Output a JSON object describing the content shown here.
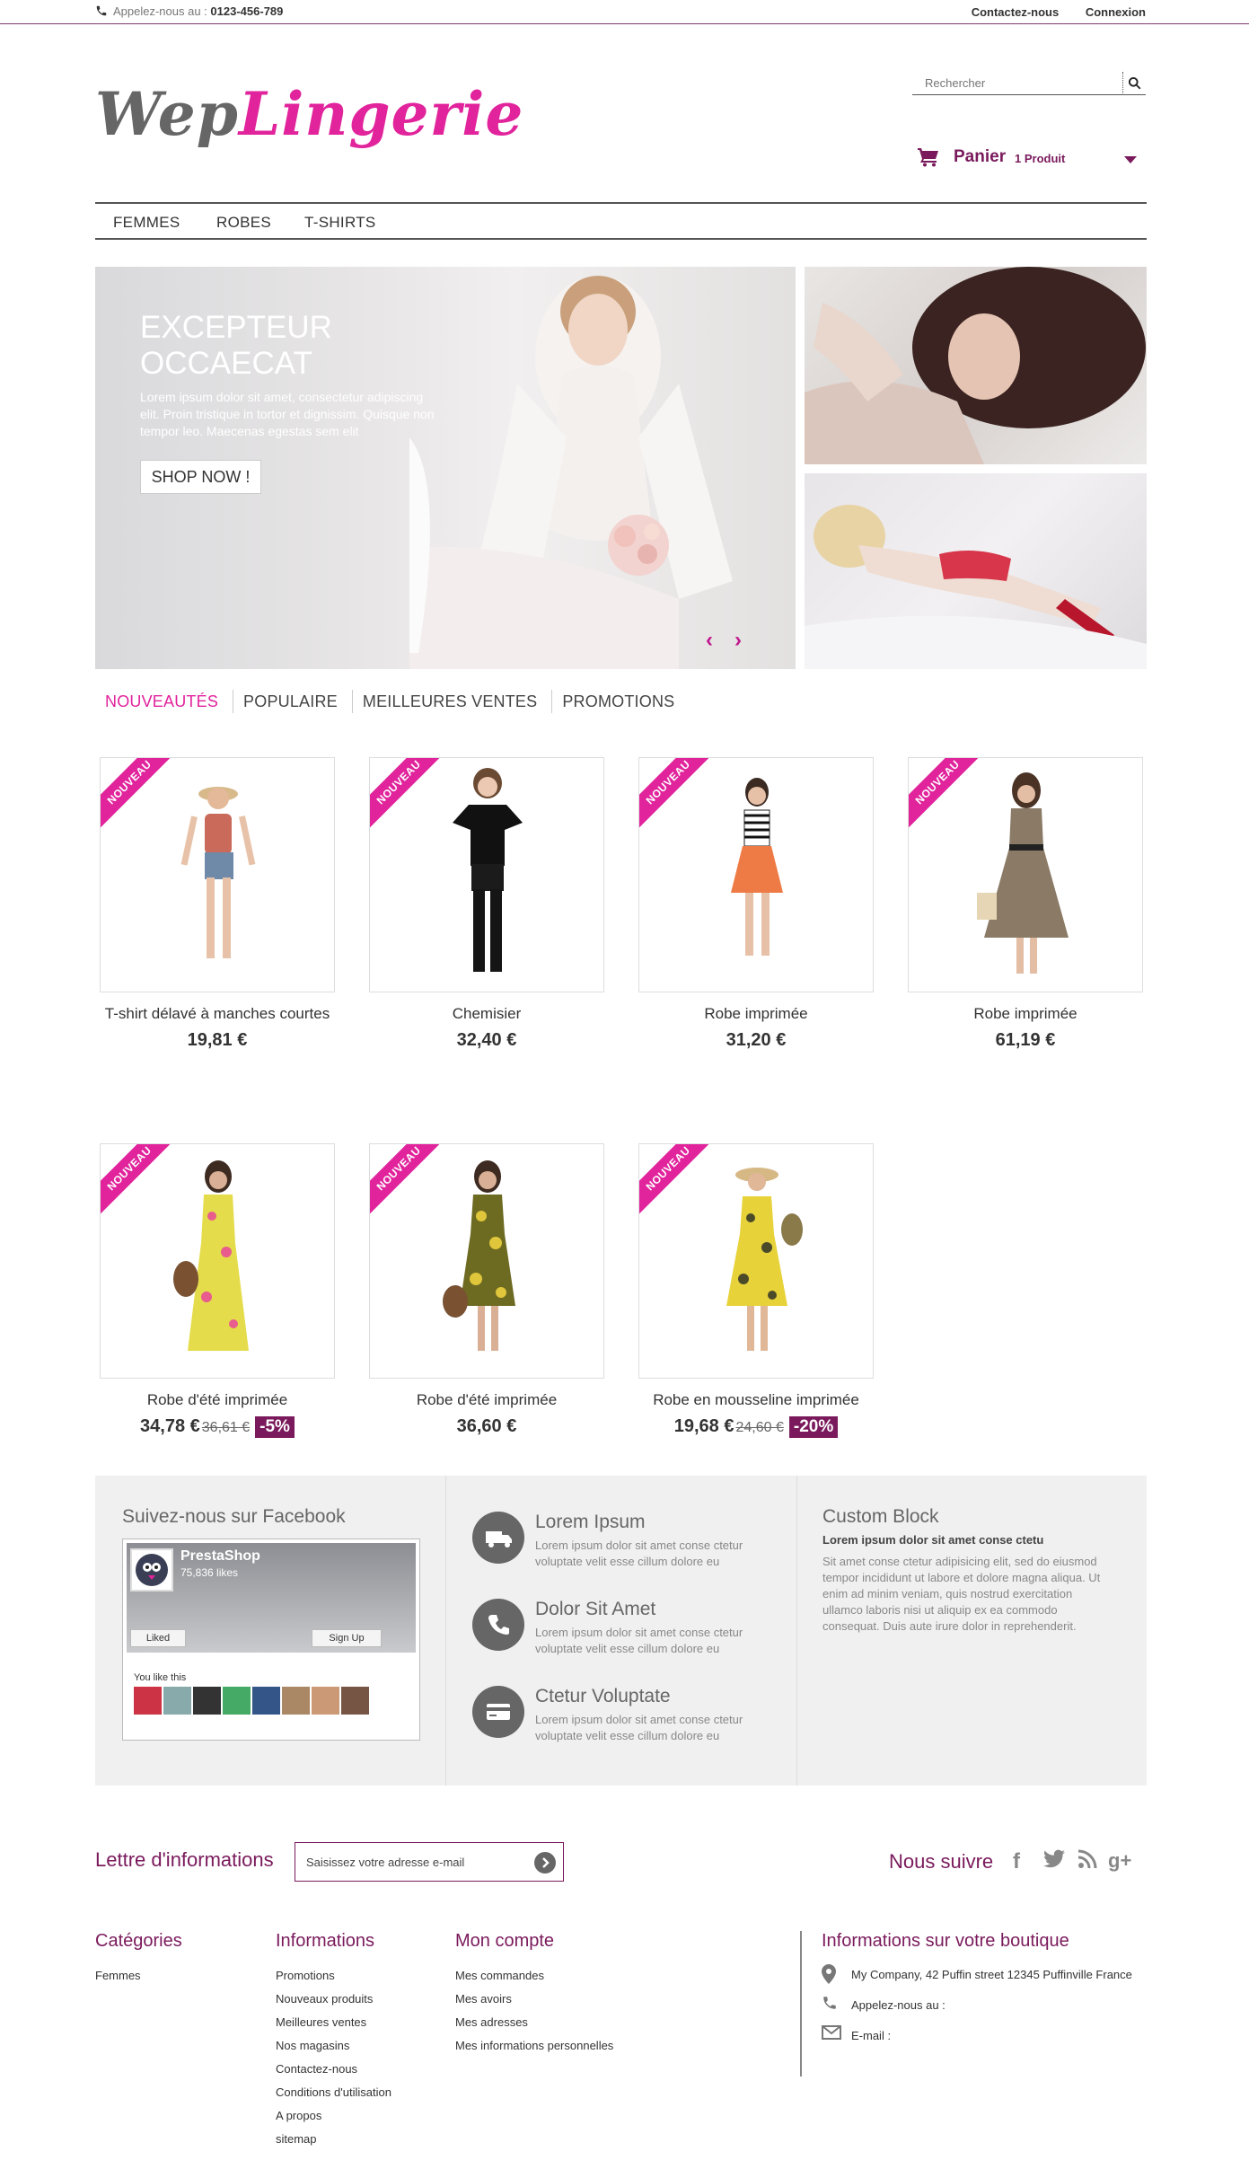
{
  "topbar": {
    "phone_prefix": "Appelez-nous au :",
    "phone_number": "0123-456-789",
    "contact": "Contactez-nous",
    "login": "Connexion"
  },
  "logo": {
    "part1": "Wep",
    "part2": "Lingerie"
  },
  "search": {
    "placeholder": "Rechercher"
  },
  "cart": {
    "label": "Panier",
    "count": "1 Produit"
  },
  "nav": [
    "FEMMES",
    "ROBES",
    "T-SHIRTS"
  ],
  "hero": {
    "title": "EXCEPTEUR OCCAECAT",
    "text": "Lorem ipsum dolor sit amet, consectetur adipiscing elit. Proin tristique in tortor et dignissim. Quisque non tempor leo. Maecenas egestas sem elit",
    "button": "SHOP NOW !"
  },
  "tabs": [
    "NOUVEAUTÉS",
    "POPULAIRE",
    "MEILLEURES VENTES",
    "PROMOTIONS"
  ],
  "ribbon": "NOUVEAU",
  "products": [
    {
      "name": "T-shirt délavé à manches courtes",
      "price": "19,81 €",
      "old": "",
      "discount": ""
    },
    {
      "name": "Chemisier",
      "price": "32,40 €",
      "old": "",
      "discount": ""
    },
    {
      "name": "Robe imprimée",
      "price": "31,20 €",
      "old": "",
      "discount": ""
    },
    {
      "name": "Robe imprimée",
      "price": "61,19 €",
      "old": "",
      "discount": ""
    },
    {
      "name": "Robe d'été imprimée",
      "price": "34,78 €",
      "old": "36,61 €",
      "discount": "-5%"
    },
    {
      "name": "Robe d'été imprimée",
      "price": "36,60 €",
      "old": "",
      "discount": ""
    },
    {
      "name": "Robe en mousseline imprimée",
      "price": "19,68 €",
      "old": "24,60 €",
      "discount": "-20%"
    }
  ],
  "facebook": {
    "title": "Suivez-nous sur Facebook",
    "page": "PrestaShop",
    "likes": "75,836 likes",
    "liked": "Liked",
    "signup": "Sign Up",
    "you_like": "You like this"
  },
  "services": [
    {
      "title": "Lorem Ipsum",
      "text": "Lorem ipsum dolor sit amet conse ctetur voluptate velit esse cillum dolore eu"
    },
    {
      "title": "Dolor Sit Amet",
      "text": "Lorem ipsum dolor sit amet conse ctetur voluptate velit esse cillum dolore eu"
    },
    {
      "title": "Ctetur Voluptate",
      "text": "Lorem ipsum dolor sit amet conse ctetur voluptate velit esse cillum dolore eu"
    }
  ],
  "custom": {
    "title": "Custom Block",
    "subtitle": "Lorem ipsum dolor sit amet conse ctetu",
    "text": "Sit amet conse ctetur adipisicing elit, sed do eiusmod tempor incididunt ut labore et dolore magna aliqua. Ut enim ad minim veniam, quis nostrud exercitation ullamco laboris nisi ut aliquip ex ea commodo consequat. Duis aute irure dolor in reprehenderit."
  },
  "newsletter": {
    "title": "Lettre d'informations",
    "placeholder": "Saisissez votre adresse e-mail",
    "follow": "Nous suivre"
  },
  "footer": {
    "categories": {
      "title": "Catégories",
      "items": [
        "Femmes"
      ]
    },
    "info": {
      "title": "Informations",
      "items": [
        "Promotions",
        "Nouveaux produits",
        "Meilleures ventes",
        "Nos magasins",
        "Contactez-nous",
        "Conditions d'utilisation",
        "A propos",
        "sitemap"
      ]
    },
    "account": {
      "title": "Mon compte",
      "items": [
        "Mes commandes",
        "Mes avoirs",
        "Mes adresses",
        "Mes informations personnelles"
      ]
    },
    "shop": {
      "title": "Informations sur votre boutique",
      "address": "My Company, 42 Puffin street 12345 Puffinville France",
      "phone": "Appelez-nous au :",
      "email": "E-mail :"
    }
  },
  "colors": {
    "accent": "#e1239c",
    "brand": "#7a1a5c"
  }
}
